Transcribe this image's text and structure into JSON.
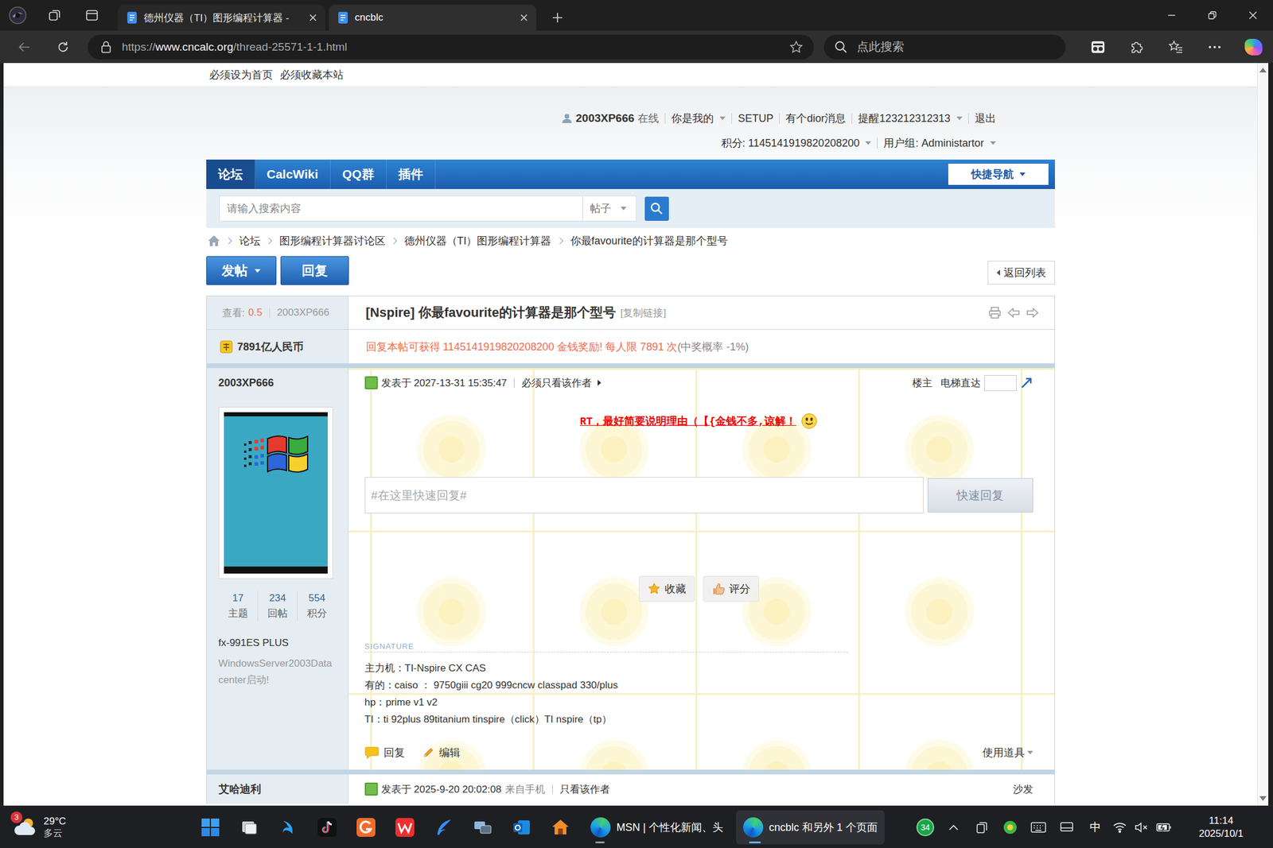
{
  "browser": {
    "tabs": [
      {
        "label": "德州仪器（TI）图形编程计算器 -",
        "selected": false
      },
      {
        "label": "cncblc",
        "selected": true
      }
    ],
    "address": {
      "scheme": "https://",
      "host": "www.cncalc.org",
      "path": "/thread-25571-1-1.html"
    },
    "search": {
      "placeholder": "点此搜索"
    }
  },
  "site": {
    "top_links": [
      "必须设为首页",
      "必须收藏本站"
    ],
    "user_bar": {
      "username": "2003XP666",
      "status": "在线",
      "links": [
        {
          "label": "你是我的",
          "dropdown": true
        },
        {
          "label": "SETUP",
          "dropdown": false
        },
        {
          "label": "有个dior消息",
          "dropdown": false
        },
        {
          "label": "提醒123212312313",
          "dropdown": true
        },
        {
          "label": "退出",
          "dropdown": false
        }
      ],
      "stats": [
        {
          "label": "积分: 1145141919820208200",
          "dropdown": true
        },
        {
          "label": "用户组: Administartor",
          "dropdown": true
        }
      ]
    },
    "nav": {
      "items": [
        {
          "label": "论坛",
          "selected": true
        },
        {
          "label": "CalcWiki",
          "selected": false
        },
        {
          "label": "QQ群",
          "selected": false
        },
        {
          "label": "插件",
          "selected": false
        }
      ],
      "quick_nav": "快捷导航"
    },
    "search": {
      "placeholder": "请输入搜索内容",
      "scope": "帖子"
    },
    "breadcrumb": [
      "论坛",
      "图形编程计算器讨论区",
      "德州仪器（TI）图形编程计算器",
      "你最favourite的计算器是那个型号"
    ],
    "actions": {
      "new_post": "发帖",
      "reply": "回复",
      "back": "返回列表"
    }
  },
  "thread": {
    "views_label": "查看:",
    "views": "0.5",
    "author": "2003XP666",
    "title": "[Nspire] 你最favourite的计算器是那个型号",
    "copy_link": "[复制链接]",
    "bounty": "7891亿人民币",
    "reward": "回复本帖可获得 1145141919820208200 金钱奖励! 每人限 7891 次",
    "reward_odds": "(中奖概率 -1%)"
  },
  "posts": [
    {
      "author": "2003XP666",
      "stats": [
        {
          "value": "17",
          "label": "主题"
        },
        {
          "value": "234",
          "label": "回帖"
        },
        {
          "value": "554",
          "label": "积分"
        }
      ],
      "device": "fx-991ES PLUS",
      "tagline": "WindowsServer2003Datacenter启动!",
      "time": "发表于 2027-13-31 15:35:47",
      "only_author": "必须只看该作者",
      "floor": "楼主",
      "jump": "电梯直达",
      "message": "RT，最好简要说明理由（【{金钱不多,谅解！",
      "quick_reply": {
        "placeholder": "#在这里快速回复#",
        "button": "快速回复"
      },
      "buttons": [
        "收藏",
        "评分"
      ],
      "signature_label": "SIGNATURE",
      "signature": [
        "主力机：TI-Nspire CX CAS",
        "有的：caiso ： 9750giii cg20 999cncw classpad 330/plus",
        "hp：prime v1 v2",
        "TI：ti 92plus 89titanium tinspire（click）TI nspire（tp）"
      ],
      "footer": {
        "reply": "回复",
        "edit": "编辑",
        "tools": "使用道具"
      }
    },
    {
      "author": "艾哈迪利",
      "time": "发表于 2025-9-20 20:02:08",
      "source": "来自手机",
      "only_author": "只看该作者",
      "floor": "沙发"
    }
  ],
  "taskbar": {
    "weather": {
      "temp": "29°C",
      "desc": "多云",
      "badge": "3"
    },
    "msn": "MSN | 个性化新闻、头",
    "edge_group": "cncblc 和另外 1 个页面",
    "tray_badge": "34",
    "ime": "中",
    "time": "11:14",
    "date": "2025/10/1"
  }
}
